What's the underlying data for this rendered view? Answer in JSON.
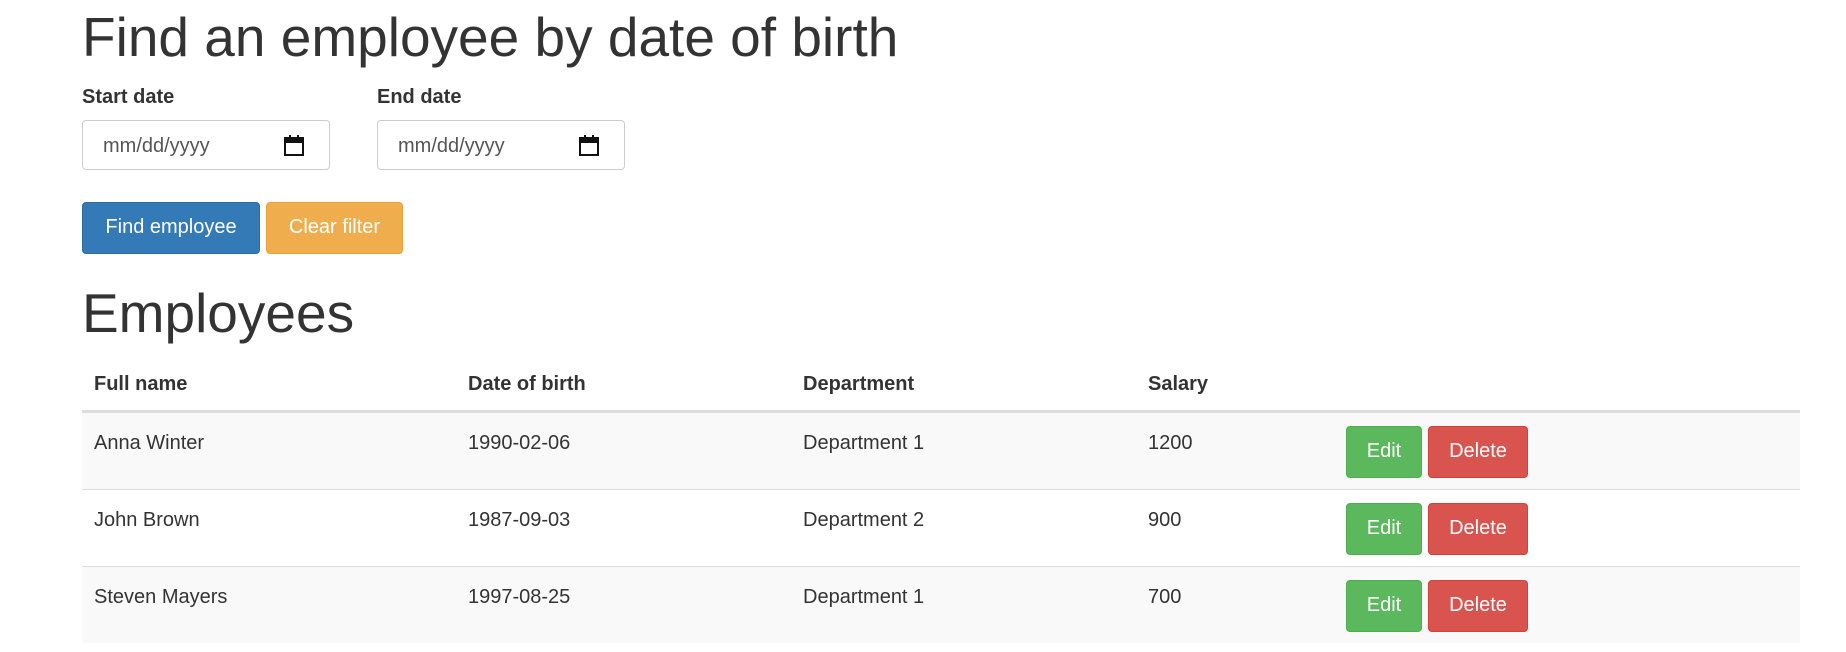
{
  "filter": {
    "title": "Find an employee by date of birth",
    "start_label": "Start date",
    "start_placeholder": "mm/dd/yyyy",
    "end_label": "End date",
    "end_placeholder": "mm/dd/yyyy",
    "find_button": "Find employee",
    "clear_button": "Clear filter"
  },
  "employees": {
    "title": "Employees",
    "columns": [
      "Full name",
      "Date of birth",
      "Department",
      "Salary"
    ],
    "rows": [
      {
        "name": "Anna Winter",
        "dob": "1990-02-06",
        "department": "Department 1",
        "salary": "1200",
        "edit": "Edit",
        "delete": "Delete"
      },
      {
        "name": "John Brown",
        "dob": "1987-09-03",
        "department": "Department 2",
        "salary": "900",
        "edit": "Edit",
        "delete": "Delete"
      },
      {
        "name": "Steven Mayers",
        "dob": "1997-08-25",
        "department": "Department 1",
        "salary": "700",
        "edit": "Edit",
        "delete": "Delete"
      }
    ]
  },
  "colors": {
    "primary": "#337ab7",
    "warning": "#f0ad4e",
    "success": "#5cb85c",
    "danger": "#d9534f"
  },
  "icons": {
    "date_picker": "calendar-icon"
  }
}
